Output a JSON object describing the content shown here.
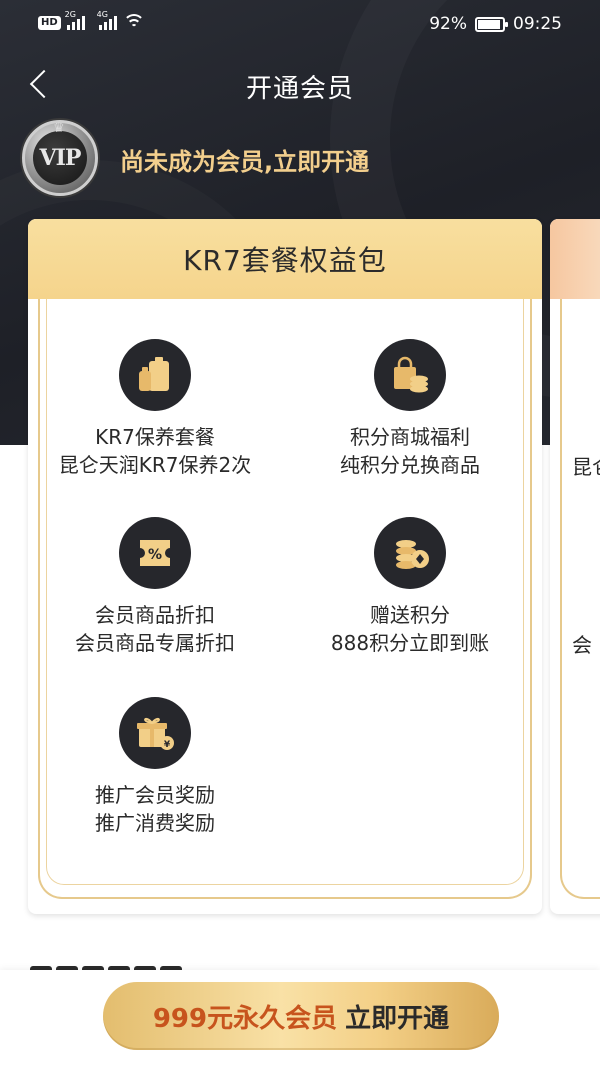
{
  "status_bar": {
    "hd": "HD",
    "sim1": "2G",
    "sim2": "4G",
    "battery": "92%",
    "time": "09:25"
  },
  "nav": {
    "title": "开通会员",
    "back_icon": "chevron-left-icon"
  },
  "member": {
    "badge_text": "VIP",
    "status": "尚未成为会员,立即开通"
  },
  "package": {
    "title": "KR7套餐权益包",
    "benefits": [
      {
        "icon": "oil-bottles-icon",
        "name": "KR7保养套餐",
        "desc": "昆仑天润KR7保养2次"
      },
      {
        "icon": "shopping-bag-coins-icon",
        "name": "积分商城福利",
        "desc": "纯积分兑换商品"
      },
      {
        "icon": "discount-ticket-icon",
        "name": "会员商品折扣",
        "desc": "会员商品专属折扣"
      },
      {
        "icon": "coin-stack-icon",
        "name": "赠送积分",
        "desc": "888积分立即到账"
      },
      {
        "icon": "gift-box-icon",
        "name": "推广会员奖励",
        "desc": "推广消费奖励"
      }
    ]
  },
  "peek_card": {
    "line1": "昆仑",
    "line2": "会"
  },
  "cta": {
    "price": "999元永久会员",
    "label": "立即开通"
  },
  "colors": {
    "gold": "#f3cf8d",
    "header_dark": "#1e2027",
    "card_header": "#f5d48c",
    "price_red": "#c7541d"
  }
}
